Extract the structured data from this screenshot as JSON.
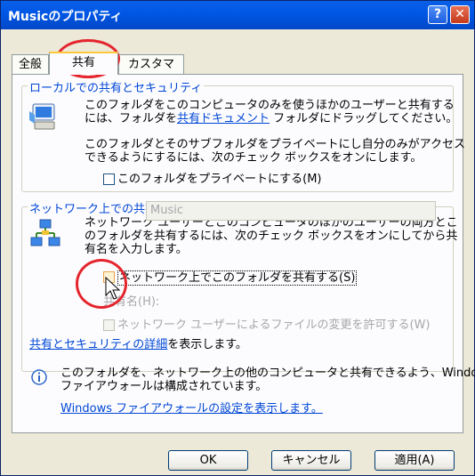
{
  "window": {
    "title": "Musicのプロパティ",
    "help_glyph": "?",
    "close_glyph": "✕"
  },
  "tabs": [
    "全般",
    "共有",
    "カスタマイズ"
  ],
  "local": {
    "legend": "ローカルでの共有とセキュリティ",
    "line1": "このフォルダをこのコンピュータのみを使うほかのユーザーと共有する",
    "line2_pre": "には、フォルダを",
    "line2_link": "共有ドキュメント",
    "line2_post": " フォルダにドラッグしてください。",
    "line3": "このフォルダとそのサブフォルダをプライベートにし自分のみがアクセス",
    "line4": "できるようにするには、次のチェック ボックスをオンにします。",
    "private_checkbox": "このフォルダをプライベートにする(M)"
  },
  "network": {
    "legend": "ネットワーク上での共有とセキュリティ",
    "line1": "ネットワーク ユーザーとこのコンピュータのほかのユーザーの両方とこ",
    "line2": "のフォルダを共有するには、次のチェック ボックスをオンにしてから共",
    "line3": "有名を入力します。",
    "share_checkbox": "ネットワーク上でこのフォルダを共有する(S)",
    "share_name_label": "共有名(H):",
    "share_name_value": "Music",
    "allow_change_checkbox": "ネットワーク ユーザーによるファイルの変更を許可する(W)",
    "details_link": "共有とセキュリティの詳細",
    "details_post": "を表示します。"
  },
  "firewall": {
    "line1": "このフォルダを、ネットワーク上の他のコンピュータと共有できるよう、Windows",
    "line2": "ファイアウォールは構成されています。",
    "link": "Windows ファイアウォールの設定を表示します。"
  },
  "buttons": {
    "ok": "OK",
    "cancel": "キャンセル",
    "apply": "適用(A)"
  },
  "colors": {
    "title_bar": "#0058e6",
    "link": "#0046d5",
    "annotation_circle": "#e4252d",
    "tab_highlight": "#ffc83c"
  }
}
